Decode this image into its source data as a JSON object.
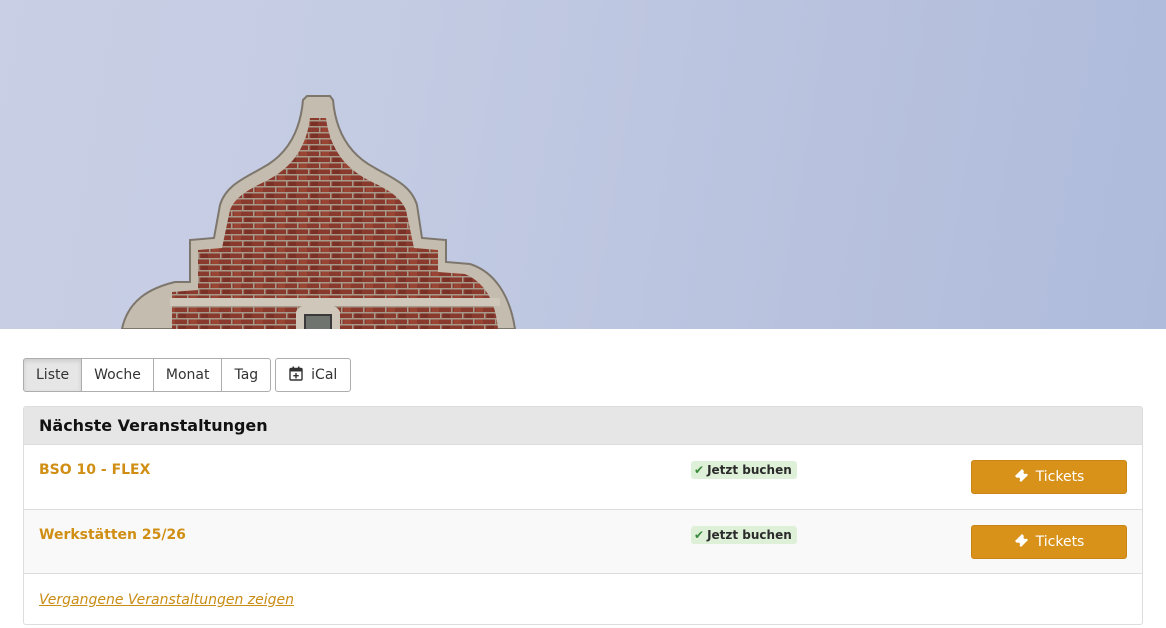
{
  "hero": {
    "image": "brick-gable-building-against-sky",
    "sky_color": "#c3cbe3",
    "brick_color": "#8a3a2c",
    "stone_color": "#c4bcae"
  },
  "view_toolbar": {
    "buttons": [
      {
        "label": "Liste",
        "active": true
      },
      {
        "label": "Woche",
        "active": false
      },
      {
        "label": "Monat",
        "active": false
      },
      {
        "label": "Tag",
        "active": false
      }
    ],
    "ical": {
      "label": "iCal",
      "icon": "calendar-plus-icon"
    }
  },
  "events_panel": {
    "title": "Nächste Veranstaltungen",
    "events": [
      {
        "title": "BSO 10 - FLEX",
        "status": {
          "label": "Jetzt buchen",
          "icon": "check-icon"
        },
        "ticket_button": {
          "label": "Tickets",
          "icon": "ticket-icon"
        }
      },
      {
        "title": "Werkstätten 25/26",
        "status": {
          "label": "Jetzt buchen",
          "icon": "check-icon"
        },
        "ticket_button": {
          "label": "Tickets",
          "icon": "ticket-icon"
        }
      }
    ],
    "past_events_link": "Vergangene Veranstaltungen zeigen"
  },
  "colors": {
    "accent": "#d8921a",
    "title_link": "#d08f14",
    "badge_bg": "#dff0d8",
    "panel_header_bg": "#e6e6e6"
  }
}
